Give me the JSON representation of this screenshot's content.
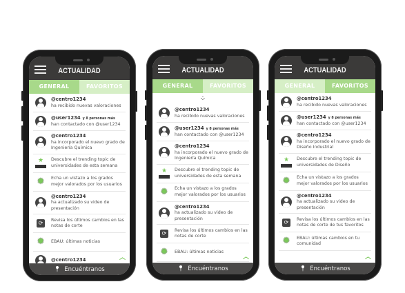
{
  "colors": {
    "accent": "#a8d98a",
    "accent_light": "#d6efc6",
    "header": "#3b3a39"
  },
  "phones": [
    {
      "title": "ACTUALIDAD",
      "tabs": [
        "GENERAL",
        "FAVORITOS"
      ],
      "active_tab": 0,
      "loading": false,
      "footer": "Encuéntranos",
      "items": [
        {
          "icon": "avatar-icon",
          "user": "@centro1234",
          "text": "ha recibido nuevas valoraciones"
        },
        {
          "icon": "avatar-icon",
          "user": "@user1234",
          "extra": "y 8 personas más",
          "text": "han contactado con @user1234"
        },
        {
          "icon": "avatar-icon",
          "user": "@centro1234",
          "text": "ha incorporado el nuevo grado de Ingeniería Química"
        },
        {
          "icon": "podium-icon",
          "text": "Descubre el trending topic de universidades de esta semana"
        },
        {
          "icon": "badge-icon",
          "text": "Echa un vistazo a los grados mejor valorados por los usuarios"
        },
        {
          "icon": "avatar-icon",
          "user": "@centro1234",
          "text": "ha actualizado su video de presentación"
        },
        {
          "icon": "refresh-icon",
          "text": "Revisa los últimos cambios en las notas de corte"
        },
        {
          "icon": "badge-icon",
          "text": "EBAU: últimas noticias"
        },
        {
          "icon": "avatar-icon",
          "user": "@centro1234",
          "text": ""
        }
      ]
    },
    {
      "title": "ACTUALIDAD",
      "tabs": [
        "GENERAL",
        "FAVORITOS"
      ],
      "active_tab": 0,
      "loading": true,
      "footer": "Encuéntranos",
      "items": [
        {
          "icon": "avatar-icon",
          "user": "@centro1234",
          "text": "ha recibido nuevas valoraciones"
        },
        {
          "icon": "avatar-icon",
          "user": "@user1234",
          "extra": "y 8 personas más",
          "text": "han contactado con @user1234"
        },
        {
          "icon": "avatar-icon",
          "user": "@centro1234",
          "text": "ha incorporado el nuevo grado de Ingeniería Química"
        },
        {
          "icon": "podium-icon",
          "text": "Descubre el trending topic de universidades de esta semana"
        },
        {
          "icon": "badge-icon",
          "text": "Echa un vistazo a los grados mejor valorados por los usuarios"
        },
        {
          "icon": "avatar-icon",
          "user": "@centro1234",
          "text": "ha actualizado su video de presentación"
        },
        {
          "icon": "refresh-icon",
          "text": "Revisa los últimos cambios en las notas de corte"
        },
        {
          "icon": "badge-icon",
          "text": "EBAU: últimas noticias"
        }
      ]
    },
    {
      "title": "ACTUALIDAD",
      "tabs": [
        "GENERAL",
        "FAVORITOS"
      ],
      "active_tab": 1,
      "loading": false,
      "footer": "Encuéntranos",
      "items": [
        {
          "icon": "avatar-icon",
          "user": "@centro1234",
          "text": "ha recibido nuevas valoraciones"
        },
        {
          "icon": "avatar-icon",
          "user": "@user1234",
          "extra": "y 8 personas más",
          "text": "han contactado con @user1234"
        },
        {
          "icon": "avatar-icon",
          "user": "@centro1234",
          "text": "ha incorporado el nuevo grado de Diseño Industrial"
        },
        {
          "icon": "podium-icon",
          "text": "Descubre el trending topic de universidades de Diseño"
        },
        {
          "icon": "badge-icon",
          "text": "Echa un vistazo a los grados mejor valorados por los usuarios"
        },
        {
          "icon": "avatar-icon",
          "user": "@centro1234",
          "text": "ha actualizado su video de presentación"
        },
        {
          "icon": "refresh-icon",
          "text": "Revisa los últimos cambios en las notas de corte de tus favoritos"
        },
        {
          "icon": "badge-icon",
          "text": "EBAU: últimas cambios en tu comunidad"
        }
      ]
    }
  ]
}
